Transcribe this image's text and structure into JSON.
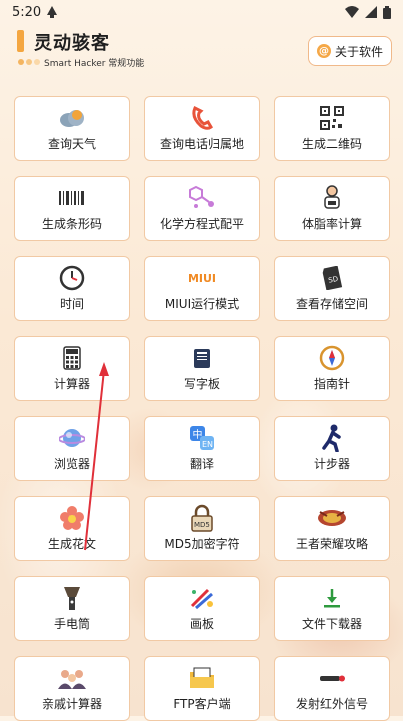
{
  "status": {
    "time": "5:20"
  },
  "header": {
    "title": "灵动骇客",
    "subtitle": "Smart Hacker 常规功能",
    "about_label": "关于软件",
    "about_icon": "@"
  },
  "tools": [
    {
      "label": "查询天气",
      "icon": "cloud-icon"
    },
    {
      "label": "查询电话归属地",
      "icon": "phone-icon"
    },
    {
      "label": "生成二维码",
      "icon": "qrcode-icon"
    },
    {
      "label": "生成条形码",
      "icon": "barcode-icon"
    },
    {
      "label": "化学方程式配平",
      "icon": "molecule-icon"
    },
    {
      "label": "体脂率计算",
      "icon": "body-fat-icon"
    },
    {
      "label": "时间",
      "icon": "clock-icon"
    },
    {
      "label": "MIUI运行模式",
      "icon": "miui-icon",
      "icon_text": "MIUI"
    },
    {
      "label": "查看存储空间",
      "icon": "sd-card-icon",
      "icon_text": "SD"
    },
    {
      "label": "计算器",
      "icon": "calculator-icon"
    },
    {
      "label": "写字板",
      "icon": "notepad-icon"
    },
    {
      "label": "指南针",
      "icon": "compass-icon"
    },
    {
      "label": "浏览器",
      "icon": "browser-icon"
    },
    {
      "label": "翻译",
      "icon": "translate-icon",
      "icon_text": "中"
    },
    {
      "label": "计步器",
      "icon": "runner-icon"
    },
    {
      "label": "生成花文",
      "icon": "flower-icon"
    },
    {
      "label": "MD5加密字符",
      "icon": "lock-icon",
      "icon_text": "MD5"
    },
    {
      "label": "王者荣耀攻略",
      "icon": "game-logo-icon"
    },
    {
      "label": "手电筒",
      "icon": "flashlight-icon"
    },
    {
      "label": "画板",
      "icon": "paint-icon"
    },
    {
      "label": "文件下载器",
      "icon": "download-icon"
    },
    {
      "label": "亲戚计算器",
      "icon": "family-icon"
    },
    {
      "label": "FTP客户端",
      "icon": "folder-icon"
    },
    {
      "label": "发射红外信号",
      "icon": "infrared-icon"
    }
  ]
}
